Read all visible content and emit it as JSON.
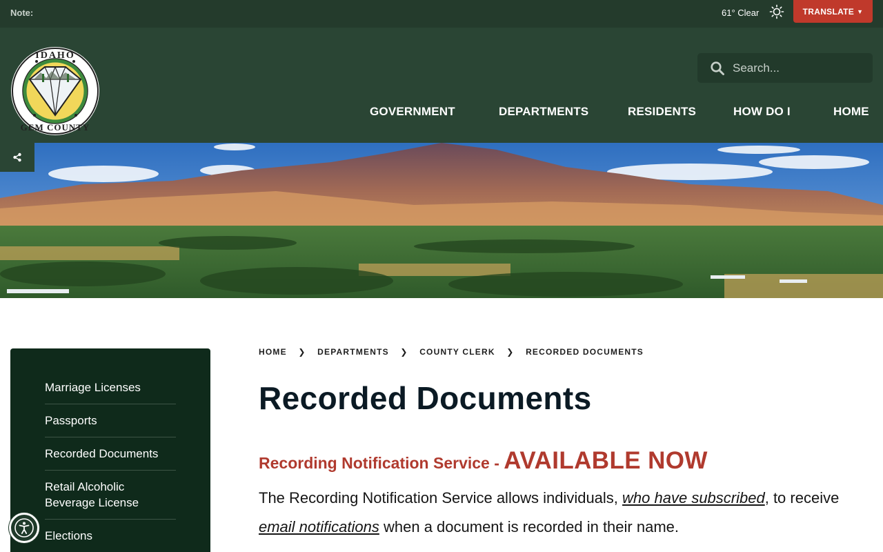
{
  "topbar": {
    "note_label": "Note:",
    "weather": "61° Clear",
    "weather_icon": "sun-icon",
    "translate_label": "TRANSLATE"
  },
  "header": {
    "logo_text_top": "IDAHO",
    "logo_text_bottom": "GEM COUNTY",
    "search_placeholder": "Search...",
    "nav": [
      {
        "label": "GOVERNMENT"
      },
      {
        "label": "DEPARTMENTS"
      },
      {
        "label": "RESIDENTS"
      },
      {
        "label": "HOW DO I"
      },
      {
        "label": "HOME"
      }
    ]
  },
  "sidebar": {
    "items": [
      {
        "label": "Marriage Licenses"
      },
      {
        "label": "Passports"
      },
      {
        "label": "Recorded Documents"
      },
      {
        "label": "Retail Alcoholic Beverage License"
      },
      {
        "label": "Elections"
      }
    ]
  },
  "breadcrumb": {
    "items": [
      "HOME",
      "DEPARTMENTS",
      "COUNTY CLERK",
      "RECORDED DOCUMENTS"
    ]
  },
  "main": {
    "title": "Recorded Documents",
    "subhead_small": "Recording Notification Service - ",
    "subhead_big": "AVAILABLE NOW",
    "para_1": "The Recording Notification Service allows individuals, ",
    "para_link_1": "who have subscribed",
    "para_2": ", to receive ",
    "para_link_2": "email notifications",
    "para_3": " when a document is recorded in their name."
  },
  "colors": {
    "topbar_bg": "#243b2c",
    "header_bg": "#2a4534",
    "sidebar_bg": "#0f2a1b",
    "accent_red": "#c0392b",
    "heading_red": "#b03a2e"
  }
}
